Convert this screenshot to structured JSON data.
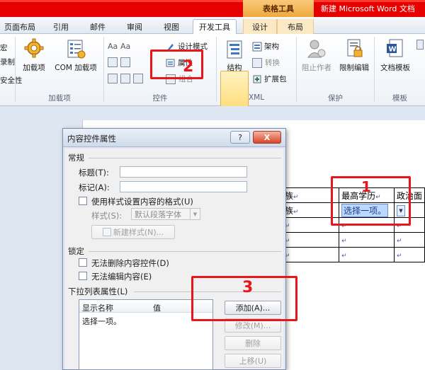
{
  "window": {
    "context_tab_group": "表格工具",
    "doc_title": "新建 Microsoft Word 文档"
  },
  "tabs": [
    {
      "label": "页面布局"
    },
    {
      "label": "引用"
    },
    {
      "label": "邮件"
    },
    {
      "label": "审阅"
    },
    {
      "label": "视图"
    },
    {
      "label": "开发工具"
    },
    {
      "label": "设计"
    },
    {
      "label": "布局"
    }
  ],
  "ribbon": {
    "edge_left_1": "宏",
    "edge_left_2": "录制",
    "edge_left_3": "安全性",
    "addins": {
      "addins_button": "加载项",
      "com_button": "COM 加载项",
      "group": "加载项"
    },
    "controls": {
      "design_mode": "设计模式",
      "properties": "属性",
      "group_menu": "组合",
      "group": "控件"
    },
    "xml": {
      "structure": "结构",
      "schema": "架构",
      "transform": "转换",
      "expansion": "扩展包",
      "group": "XML"
    },
    "protect": {
      "block_authors": "阻止作者",
      "restrict_editing": "限制编辑",
      "group": "保护"
    },
    "templates": {
      "document_template": "文档模板",
      "group": "模板"
    }
  },
  "document": {
    "table": {
      "row0": [
        "族",
        "最高学历",
        "政治面"
      ],
      "row1_col0": "族",
      "dropdown_value": "选择一项。"
    }
  },
  "dialog": {
    "title": "内容控件属性",
    "help_btn": "?",
    "close_btn": "X",
    "general": {
      "header": "常规",
      "title_label": "标题(T):",
      "title_value": "",
      "tag_label": "标记(A):",
      "tag_value": "",
      "use_style_label": "使用样式设置内容的格式(U)",
      "style_label": "样式(S):",
      "style_value": "默认段落字体",
      "new_style_btn": "新建样式(N)..."
    },
    "locking": {
      "header": "锁定",
      "cannot_delete": "无法删除内容控件(D)",
      "cannot_edit": "无法编辑内容(E)"
    },
    "dropdown_props": {
      "header": "下拉列表属性(L)",
      "col_display": "显示名称",
      "col_value": "值",
      "items": [
        {
          "display": "选择一项。",
          "value": ""
        }
      ],
      "add_btn": "添加(A)...",
      "modify_btn": "修改(M)...",
      "remove_btn": "删除",
      "moveup_btn": "上移(U)"
    }
  },
  "annotations": {
    "one": "1",
    "two": "2",
    "three": "3"
  }
}
